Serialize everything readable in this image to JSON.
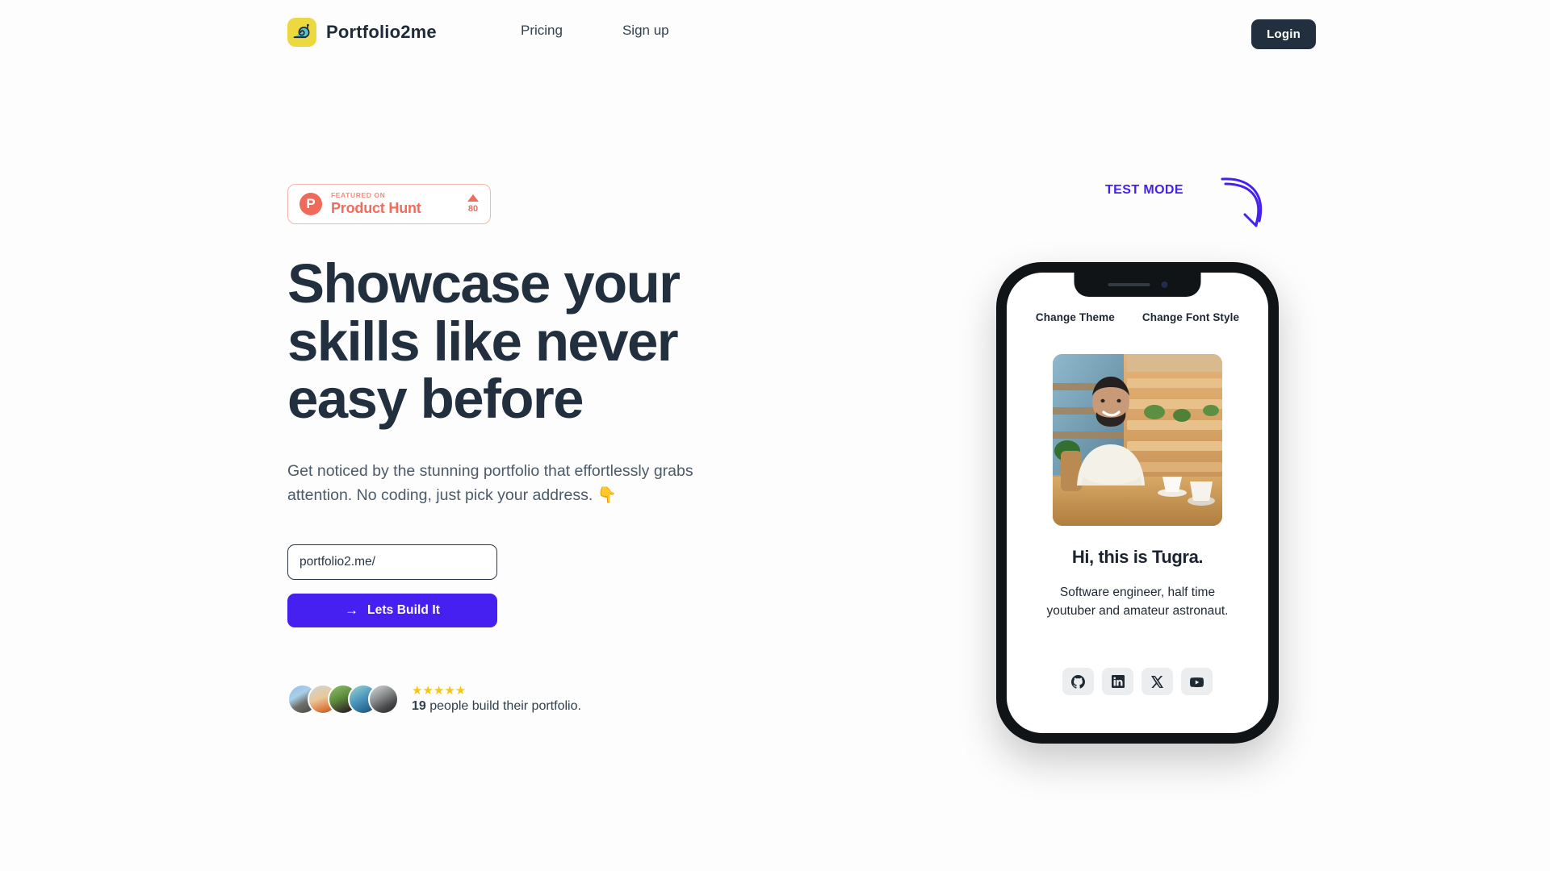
{
  "nav": {
    "brand": "Portfolio2me",
    "logo_icon": "snail-logo-icon",
    "logo_bg": "#ecd93f",
    "links": [
      {
        "label": "Pricing"
      },
      {
        "label": "Sign up"
      }
    ],
    "login_label": "Login"
  },
  "hero": {
    "badge": {
      "logo_letter": "P",
      "featured_on": "FEATURED ON",
      "product": "Product Hunt",
      "caret": "upvote-caret-icon",
      "votes": "80",
      "accent": "#ee6d5d"
    },
    "headline": "Showcase your skills like never easy before",
    "subhead": "Get noticed by the stunning portfolio that effortlessly grabs attention. No coding, just pick your address. 👇",
    "input_value": "portfolio2.me/",
    "input_placeholder": "portfolio2.me/",
    "cta_arrow": "→",
    "cta_label": "Lets Build It",
    "cta_color": "#4520f0"
  },
  "proof": {
    "stars": "★★★★★",
    "star_color": "#f5c518",
    "count": "19",
    "text": " people build their portfolio.",
    "avatars": [
      {
        "name": "avatar-1"
      },
      {
        "name": "avatar-2"
      },
      {
        "name": "avatar-3"
      },
      {
        "name": "avatar-4"
      },
      {
        "name": "avatar-5"
      }
    ]
  },
  "preview": {
    "test_mode_label": "TEST MODE",
    "test_mode_color": "#4520f0",
    "controls": [
      {
        "label": "Change Theme"
      },
      {
        "label": "Change Font Style"
      }
    ],
    "profile_name": "Hi, this is Tugra.",
    "profile_bio": "Software engineer, half time youtuber and amateur astronaut.",
    "socials": [
      {
        "name": "github-icon"
      },
      {
        "name": "linkedin-icon"
      },
      {
        "name": "x-twitter-icon"
      },
      {
        "name": "youtube-icon"
      }
    ]
  }
}
